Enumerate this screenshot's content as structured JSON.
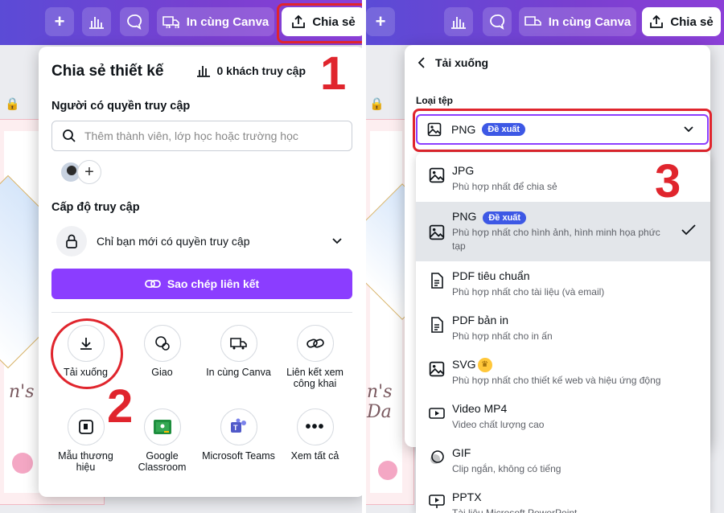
{
  "toolbar": {
    "add_icon": "plus-icon",
    "insights_icon": "bar-chart-icon",
    "comment_icon": "comment-icon",
    "print_label": "In cùng Canva",
    "share_label": "Chia sẻ"
  },
  "share_panel": {
    "title": "Chia sẻ thiết kế",
    "visitors": "0 khách truy cập",
    "people_label": "Người có quyền truy cập",
    "search_placeholder": "Thêm thành viên, lớp học hoặc trường học",
    "access_level_label": "Cấp độ truy cập",
    "access_value": "Chỉ bạn mới có quyền truy cập",
    "copy_link": "Sao chép liên kết",
    "grid": [
      {
        "label": "Tải xuống",
        "icon": "download-icon"
      },
      {
        "label": "Giao",
        "icon": "assign-icon"
      },
      {
        "label": "In cùng Canva",
        "icon": "truck-icon"
      },
      {
        "label": "Liên kết xem công khai",
        "icon": "link-icon"
      },
      {
        "label": "Mẫu thương hiệu",
        "icon": "brand-template-icon"
      },
      {
        "label": "Google Classroom",
        "icon": "google-classroom-icon"
      },
      {
        "label": "Microsoft Teams",
        "icon": "teams-icon"
      },
      {
        "label": "Xem tất cả",
        "icon": "more-icon"
      }
    ]
  },
  "download_panel": {
    "back_title": "Tải xuống",
    "file_type_label": "Loại tệp",
    "selected_type": "PNG",
    "badge": "Đề xuất",
    "options": [
      {
        "name": "JPG",
        "desc": "Phù hợp nhất để chia sẻ"
      },
      {
        "name": "PNG",
        "desc": "Phù hợp nhất cho hình ảnh, hình minh họa phức tạp",
        "badge": "Đề xuất",
        "selected": true
      },
      {
        "name": "PDF tiêu chuẩn",
        "desc": "Phù hợp nhất cho tài liệu (và email)"
      },
      {
        "name": "PDF bản in",
        "desc": "Phù hợp nhất cho in ấn"
      },
      {
        "name": "SVG",
        "desc": "Phù hợp nhất cho thiết kế web và hiệu ứng động"
      },
      {
        "name": "Video MP4",
        "desc": "Video chất lượng cao"
      },
      {
        "name": "GIF",
        "desc": "Clip ngắn, không có tiếng"
      },
      {
        "name": "PPTX",
        "desc": "Tài liệu Microsoft PowerPoint"
      }
    ]
  },
  "annotations": {
    "step1": "1",
    "step2": "2",
    "step3": "3",
    "color": "#e0252d"
  },
  "artboard_text": "n's Da"
}
